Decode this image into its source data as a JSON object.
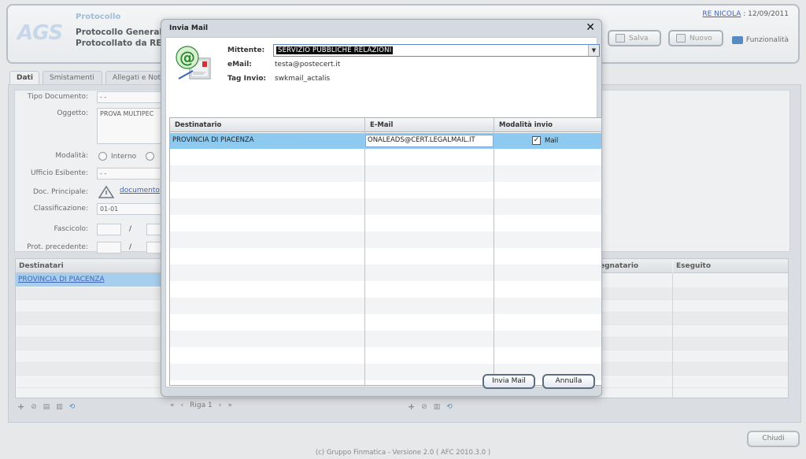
{
  "header": {
    "logo": "AGS",
    "app_title": "Protocollo",
    "line1": "Protocollo Generale",
    "line2": "Protocollato da RE  N",
    "user": "RE  NICOLA",
    "date_sep": " : 12/09/2011",
    "buttons": {
      "save": "Salva",
      "new": "Nuovo",
      "functions": "Funzionalità"
    }
  },
  "tabs": [
    "Dati",
    "Smistamenti",
    "Allegati e Not"
  ],
  "form": {
    "tipo_label": "Tipo Documento:",
    "tipo_value": "- -",
    "oggetto_label": "Oggetto:",
    "oggetto_value": "PROVA MULTIPEC",
    "modalita_label": "Modalità:",
    "modalita_option": "Interno",
    "ufficio_label": "Ufficio Esibente:",
    "ufficio_value": "- -",
    "doc_label": "Doc. Principale:",
    "doc_value": "documento",
    "class_label": "Classificazione:",
    "class_value": "01-01",
    "fascicolo_label": "Fascicolo:",
    "slash": "/",
    "prot_label": "Prot. precedente:"
  },
  "grid": {
    "col_destinatari": "Destinatari",
    "col_assegnatario": "egnatario",
    "col_eseguito": "Eseguito",
    "row1": "PROVINCIA DI PIACENZA",
    "pager": "Riga 1"
  },
  "dialog": {
    "title": "Invia Mail",
    "close": "✕",
    "mittente_label": "Mittente:",
    "mittente_value": "SERVIZIO PUBBLICHE RELAZIONI",
    "email_label": "eMail:",
    "email_value": "testa@postecert.it",
    "tag_label": "Tag Invio:",
    "tag_value": "swkmail_actalis",
    "table": {
      "headers": [
        "Destinatario",
        "E-Mail",
        "Modalità invio"
      ],
      "rows": [
        {
          "destinatario": "PROVINCIA DI PIACENZA",
          "email": "ONALEADS@CERT.LEGALMAIL.IT",
          "modalita": "Mail",
          "checked": true
        }
      ]
    },
    "buttons": {
      "send": "Invia Mail",
      "cancel": "Annulla"
    }
  },
  "footer_button": "Chiudi",
  "footer": "(c) Gruppo Finmatica - Versione 2.0  ( AFC 2010.3.0 )",
  "colors": {
    "accent": "#8ec9ef",
    "link": "#3960b8",
    "selection": "#0b0b0b"
  }
}
